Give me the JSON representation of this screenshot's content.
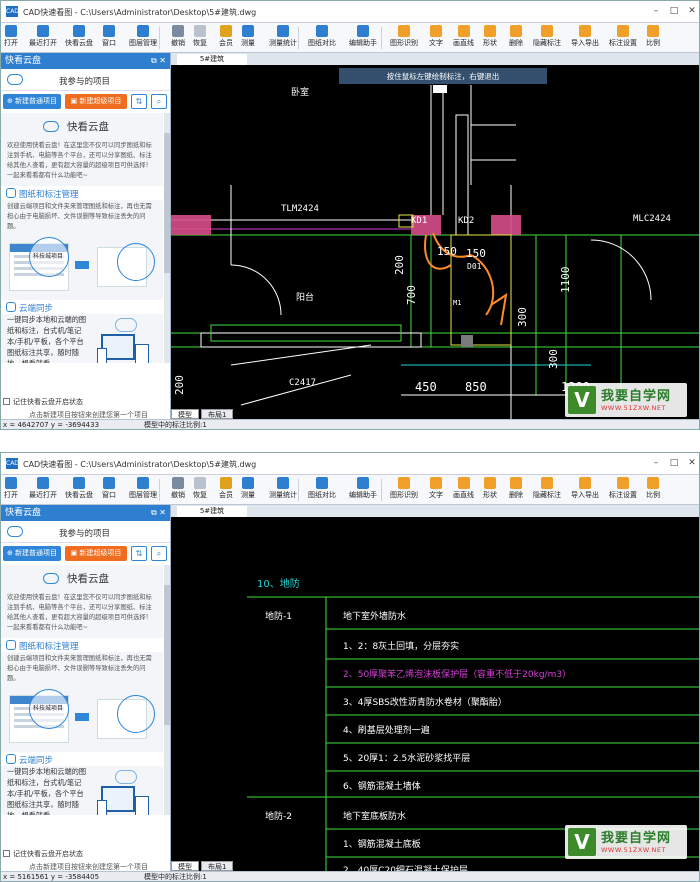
{
  "app": {
    "title": "CAD快速看图 - C:\\Users\\Administrator\\Desktop\\5#建筑.dwg",
    "logo": "CAD"
  },
  "toolbar": [
    {
      "label": "打开",
      "icon": "folder-icon",
      "color": "#2f7fd0"
    },
    {
      "label": "最近打开",
      "icon": "clock-icon",
      "color": "#2f7fd0"
    },
    {
      "label": "快看云盘",
      "icon": "cloud-icon",
      "color": "#2f7fd0"
    },
    {
      "label": "窗口",
      "icon": "window-icon",
      "color": "#2f7fd0"
    },
    {
      "label": "图层管理",
      "icon": "layers-icon",
      "color": "#2f7fd0"
    },
    {
      "label": "撤销",
      "icon": "undo-icon",
      "color": "#7a8aa0"
    },
    {
      "label": "恢复",
      "icon": "redo-icon",
      "color": "#b9c1cc"
    },
    {
      "label": "会员",
      "icon": "vip-icon",
      "color": "#e0a21b"
    },
    {
      "label": "测量",
      "icon": "measure-icon",
      "color": "#2f7fd0"
    },
    {
      "label": "测量统计",
      "icon": "measure-stats-icon",
      "color": "#2f7fd0"
    },
    {
      "label": "图纸对比",
      "icon": "compare-icon",
      "color": "#2f7fd0"
    },
    {
      "label": "编辑助手",
      "icon": "edit-helper-icon",
      "color": "#2f7fd0"
    },
    {
      "label": "图形识别",
      "icon": "recognize-icon",
      "color": "#f0a028"
    },
    {
      "label": "文字",
      "icon": "text-icon",
      "color": "#f0a028"
    },
    {
      "label": "画直线",
      "icon": "line-icon",
      "color": "#f0a028"
    },
    {
      "label": "形状",
      "icon": "shape-icon",
      "color": "#f0a028"
    },
    {
      "label": "删除",
      "icon": "erase-icon",
      "color": "#f0a028"
    },
    {
      "label": "隐藏标注",
      "icon": "hide-mark-icon",
      "color": "#f0a028"
    },
    {
      "label": "导入导出",
      "icon": "import-export-icon",
      "color": "#f0a028"
    },
    {
      "label": "标注设置",
      "icon": "mark-settings-icon",
      "color": "#f0a028"
    },
    {
      "label": "比例",
      "icon": "scale-icon",
      "color": "#f0a028"
    }
  ],
  "panel": {
    "title": "快看云盘",
    "my_projects": "我参与的项目",
    "btn_new_normal": "新建普通项目",
    "btn_new_super": "新建超级项目",
    "intro_title": "快看云盘",
    "intro_text": "欢迎使用快看云盘！在这里您不仅可以同步图纸和标注到手机、电脑等各个平台，还可以分享图纸、标注给其他人查看，更有超大容量的超级项目可供选择！一起来看看都有什么功能吧~",
    "sect1_title": "图纸和标注管理",
    "sect1_text": "创建云端项目和文件夹来管理图纸和标注，再也无需担心由于电脑损坏、文件误删等导致标注丢失的问题。",
    "illus_label": "科技城项目",
    "sect2_title": "云端同步",
    "sect2_text": "一键同步本地和云端的图纸和标注，台式机/笔记本/手机/平板，各个平台图纸标注共享，随时随地，想看就看",
    "remember": "记住快看云盘开启状态",
    "hint": "点击新建项目按钮来创建您第一个项目"
  },
  "tabs": {
    "drawing": "5#建筑",
    "model": "模型",
    "layout": "布局1"
  },
  "screens": [
    {
      "coord": "x = 4642707  y = -3694433",
      "scale": "模型中的标注比例:1",
      "banner": "按住鼠标左键绘制标注，右键退出",
      "labels": [
        "卧室",
        "TLM2424",
        "KD1",
        "KD2",
        "150",
        "150",
        "MLC2424",
        "阳台",
        "C2417",
        "D01",
        "M1",
        "700",
        "200",
        "1100",
        "300",
        "300",
        "450",
        "850",
        "1200",
        "200"
      ]
    },
    {
      "coord": "x = 5161561  y = -3584405",
      "scale": "模型中的标注比例:1",
      "heading": "10、地防",
      "rows": [
        {
          "left": "地防-1",
          "right": "地下室外墙防水"
        },
        {
          "left": "",
          "right": "1、2：8灰土回填，分层夯实"
        },
        {
          "left": "",
          "right": "2、50厚聚苯乙烯泡沫板保护层（容重不低于20kg/m3）"
        },
        {
          "left": "",
          "right": "3、4厚SBS改性沥青防水卷材（聚酯胎）"
        },
        {
          "left": "",
          "right": "4、刷基层处理剂一遍"
        },
        {
          "left": "",
          "right": "5、20厚1：2.5水泥砂浆找平层"
        },
        {
          "left": "",
          "right": "6、钢筋混凝土墙体"
        },
        {
          "left": "地防-2",
          "right": "地下室底板防水"
        },
        {
          "left": "",
          "right": "1、钢筋混凝土底板"
        },
        {
          "left": "",
          "right": "2、40厚C20细石混凝土保护层"
        }
      ]
    }
  ],
  "watermark": {
    "mark": "V",
    "text": "我要自学网",
    "url": "WWW.51ZXW.NET"
  },
  "colors": {
    "accent": "#2f7fd0",
    "orange": "#f06c1e",
    "cad_bg": "#000000",
    "cad_cyan": "#22d3d3",
    "cad_green": "#3fe03f",
    "cad_magenta": "#d63fd6",
    "cad_yellow": "#e8e84a"
  }
}
